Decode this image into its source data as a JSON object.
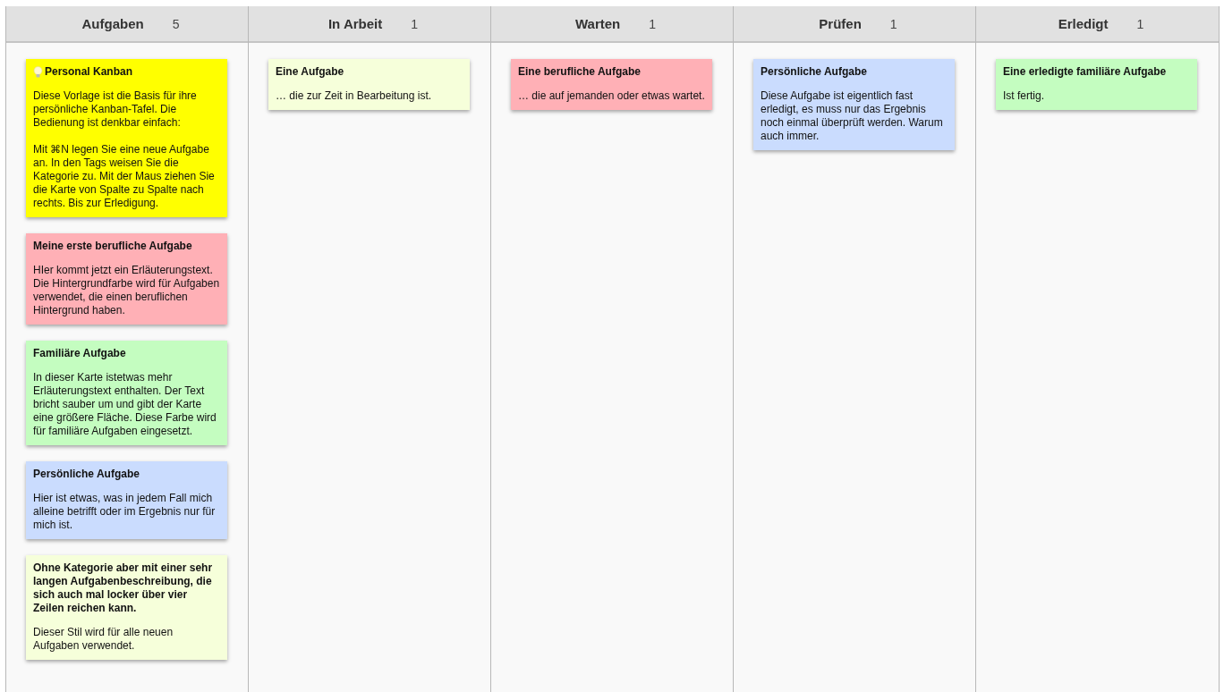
{
  "columns": [
    {
      "title": "Aufgaben",
      "count": "5",
      "cards": [
        {
          "kind": "info",
          "color": "#ffff00",
          "title": "Personal Kanban",
          "text": [
            "Diese Vorlage ist die Basis für ihre persönliche Kanban-Tafel. Die Bedienung ist denkbar einfach:",
            "Mit ⌘N legen Sie eine neue Aufgabe an. In den Tags weisen Sie die Kategorie zu. Mit der Maus ziehen Sie die Karte von Spalte zu Spalte nach rechts. Bis zur Erledigung."
          ]
        },
        {
          "kind": "task",
          "color": "#ffb0b6",
          "title": "Meine erste berufliche Aufgabe",
          "text": [
            "HIer kommt jetzt ein Erläuterungstext. Die Hintergrundfarbe wird für Aufgaben verwendet, die einen beruflichen Hintergrund haben."
          ]
        },
        {
          "kind": "task",
          "color": "#c4fdc0",
          "title": "Familiäre Aufgabe",
          "text": [
            "In dieser Karte istetwas mehr Erläuterungstext enthalten. Der Text bricht sauber um und gibt der Karte eine größere Fläche. Diese Farbe wird für familiäre Aufgaben eingesetzt."
          ]
        },
        {
          "kind": "task",
          "color": "#cadcfe",
          "title": "Persönliche Aufgabe",
          "text": [
            "Hier ist etwas, was in jedem Fall mich alleine betrifft oder im Ergebnis nur für mich ist."
          ]
        },
        {
          "kind": "task",
          "color": "#f6ffda",
          "title": "Ohne Kategorie aber mit einer sehr langen Aufgabenbeschreibung, die sich auch mal locker über vier Zeilen reichen kann.",
          "text": [
            "Dieser Stil wird für alle neuen Aufgaben verwendet."
          ]
        }
      ]
    },
    {
      "title": "In Arbeit",
      "count": "1",
      "cards": [
        {
          "kind": "task",
          "color": "#f6ffda",
          "title": "Eine Aufgabe",
          "text": [
            "… die zur Zeit in Bearbeitung ist."
          ]
        }
      ]
    },
    {
      "title": "Warten",
      "count": "1",
      "cards": [
        {
          "kind": "task",
          "color": "#ffb0b6",
          "title": "Eine berufliche Aufgabe",
          "text": [
            "… die auf jemanden oder etwas wartet."
          ]
        }
      ]
    },
    {
      "title": "Prüfen",
      "count": "1",
      "cards": [
        {
          "kind": "task",
          "color": "#cadcfe",
          "title": "Persönliche Aufgabe",
          "text": [
            "Diese Aufgabe ist eigentlich fast erledigt, es muss nur das Ergebnis noch einmal überprüft werden. Warum auch immer."
          ]
        }
      ]
    },
    {
      "title": "Erledigt",
      "count": "1",
      "cards": [
        {
          "kind": "task",
          "color": "#c4fdc0",
          "title": "Eine erledigte familiäre Aufgabe",
          "text": [
            "Ist fertig."
          ]
        }
      ]
    }
  ]
}
